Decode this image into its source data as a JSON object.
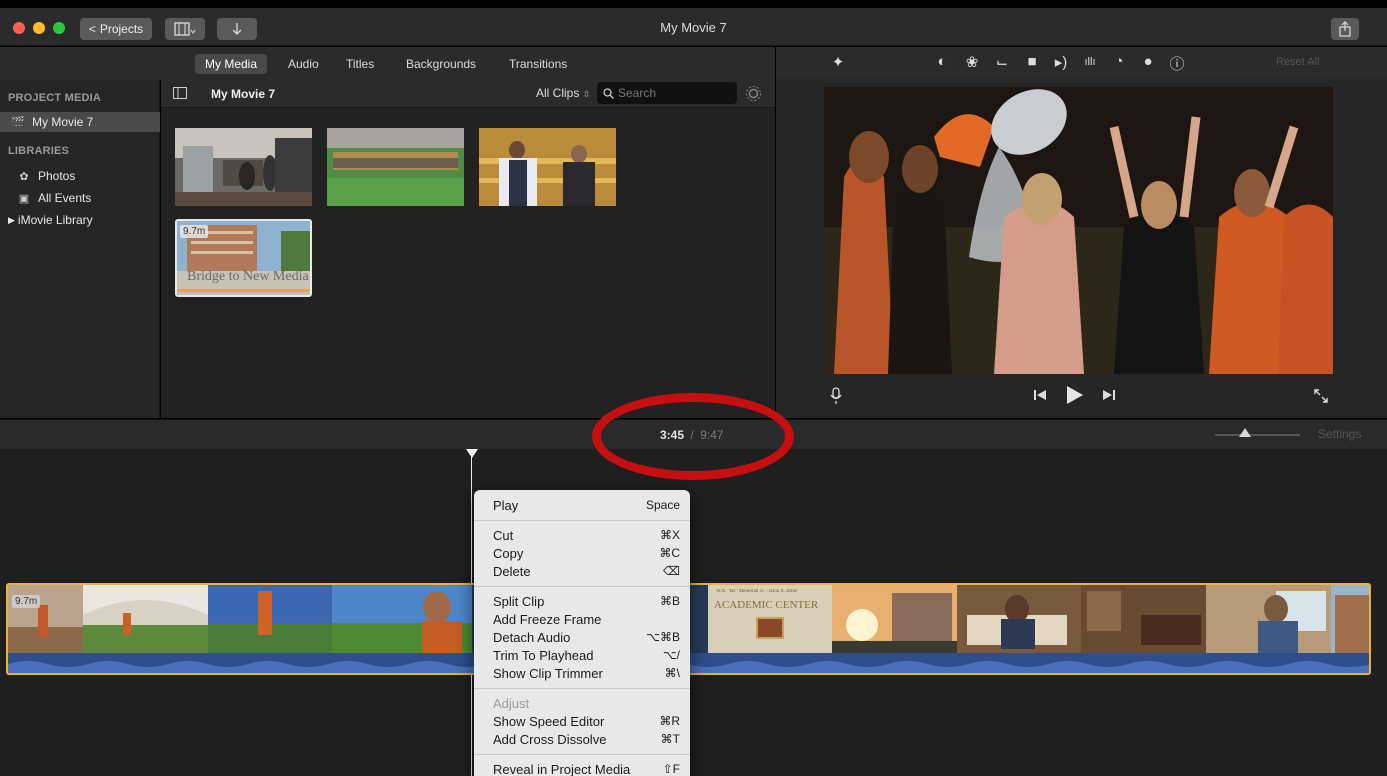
{
  "window": {
    "title": "My Movie 7",
    "projects_button": "Projects"
  },
  "media_tabs": [
    "My Media",
    "Audio",
    "Titles",
    "Backgrounds",
    "Transitions"
  ],
  "sidebar": {
    "project_media_heading": "PROJECT MEDIA",
    "project_item": "My Movie 7",
    "libraries_heading": "LIBRARIES",
    "library_items": [
      "Photos",
      "All Events",
      "iMovie Library"
    ]
  },
  "browser": {
    "title": "My Movie 7",
    "filter": "All Clips",
    "search_placeholder": "Search",
    "clip_badge": "9.7m",
    "thumb_caption": "Bridge to New Media"
  },
  "viewer": {
    "reset_all": "Reset All"
  },
  "timeline": {
    "current_time": "3:45",
    "separator": "/",
    "total_time": "9:47",
    "settings": "Settings",
    "clip_badge": "9.7m",
    "academic_sign_small": "W.A. \"Bo\" Memorial Jr. - Dana X. Bible",
    "academic_sign": "ACADEMIC CENTER"
  },
  "context_menu": {
    "items": [
      {
        "label": "Play",
        "key": "Space"
      },
      {
        "label": "Cut",
        "key": "⌘X"
      },
      {
        "label": "Copy",
        "key": "⌘C"
      },
      {
        "label": "Delete",
        "key": "⌫"
      },
      {
        "label": "Split Clip",
        "key": "⌘B"
      },
      {
        "label": "Add Freeze Frame",
        "key": ""
      },
      {
        "label": "Detach Audio",
        "key": "⌥⌘B"
      },
      {
        "label": "Trim To Playhead",
        "key": "⌥/"
      },
      {
        "label": "Show Clip Trimmer",
        "key": "⌘\\"
      },
      {
        "label": "Adjust",
        "key": ""
      },
      {
        "label": "Show Speed Editor",
        "key": "⌘R"
      },
      {
        "label": "Add Cross Dissolve",
        "key": "⌘T"
      },
      {
        "label": "Reveal in Project Media",
        "key": "⇧F"
      }
    ]
  },
  "colors": {
    "accent_yellow": "#e9b23a",
    "annotation_red": "#c60f10",
    "audio_blue": "#2f4e8c"
  }
}
